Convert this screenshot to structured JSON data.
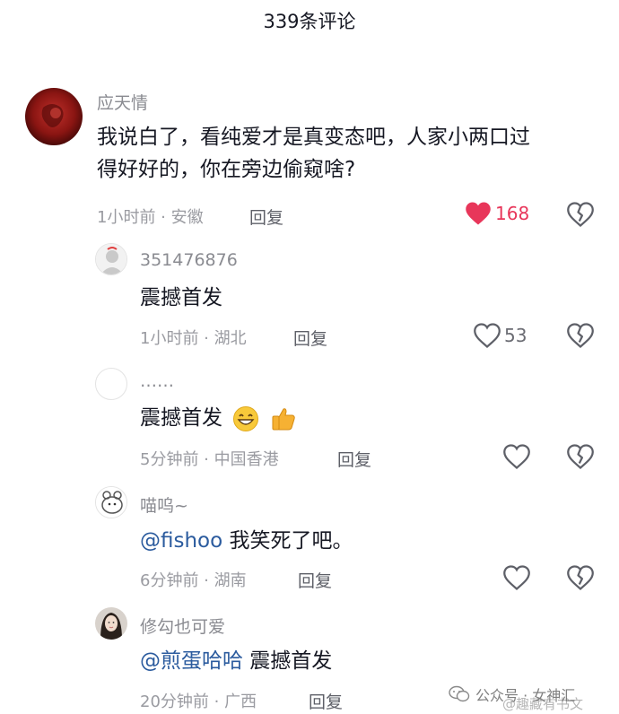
{
  "header": {
    "title": "339条评论"
  },
  "comments": [
    {
      "username": "应天情",
      "text_line1": "我说白了，看纯爱才是真变态吧，人家小两口过",
      "text_line2": "得好好的，你在旁边偷窥啥?",
      "meta": "1小时前 · 安徽",
      "reply_label": "回复",
      "likes": "168"
    },
    {
      "username": "351476876",
      "text": "震撼首发",
      "meta": "1小时前 · 湖北",
      "reply_label": "回复",
      "likes": "53"
    },
    {
      "username": "……",
      "text": "震撼首发",
      "meta": "5分钟前 · 中国香港",
      "reply_label": "回复",
      "emojis": [
        "grin-emoji",
        "thumbs-up-emoji"
      ]
    },
    {
      "username": "喵呜~",
      "mention": "@fishoo",
      "text": " 我笑死了吧。",
      "meta": "6分钟前 · 湖南",
      "reply_label": "回复"
    },
    {
      "username": "修勾也可爱",
      "mention": "@煎蛋哈哈",
      "text": " 震撼首发",
      "meta": "20分钟前 · 广西",
      "reply_label": "回复"
    }
  ],
  "watermark": {
    "text": "公众号 · 女神汇",
    "overlay": "@趣藏有书文"
  },
  "colors": {
    "like_active": "#e8365a",
    "mention": "#2b5b9e",
    "meta": "#9a9ba1"
  }
}
